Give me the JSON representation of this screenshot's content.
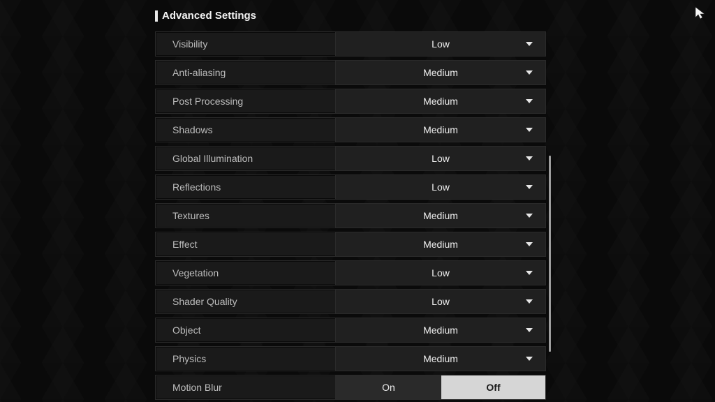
{
  "title": "Advanced Settings",
  "settings": [
    {
      "key": "visibility",
      "label": "Visibility",
      "value": "Low"
    },
    {
      "key": "anti-aliasing",
      "label": "Anti-aliasing",
      "value": "Medium"
    },
    {
      "key": "post-processing",
      "label": "Post Processing",
      "value": "Medium"
    },
    {
      "key": "shadows",
      "label": "Shadows",
      "value": "Medium"
    },
    {
      "key": "global-illumination",
      "label": "Global Illumination",
      "value": "Low"
    },
    {
      "key": "reflections",
      "label": "Reflections",
      "value": "Low"
    },
    {
      "key": "textures",
      "label": "Textures",
      "value": "Medium"
    },
    {
      "key": "effect",
      "label": "Effect",
      "value": "Medium"
    },
    {
      "key": "vegetation",
      "label": "Vegetation",
      "value": "Low"
    },
    {
      "key": "shader-quality",
      "label": "Shader Quality",
      "value": "Low"
    },
    {
      "key": "object",
      "label": "Object",
      "value": "Medium"
    },
    {
      "key": "physics",
      "label": "Physics",
      "value": "Medium"
    }
  ],
  "motionBlur": {
    "label": "Motion Blur",
    "onLabel": "On",
    "offLabel": "Off",
    "selected": "Off"
  }
}
